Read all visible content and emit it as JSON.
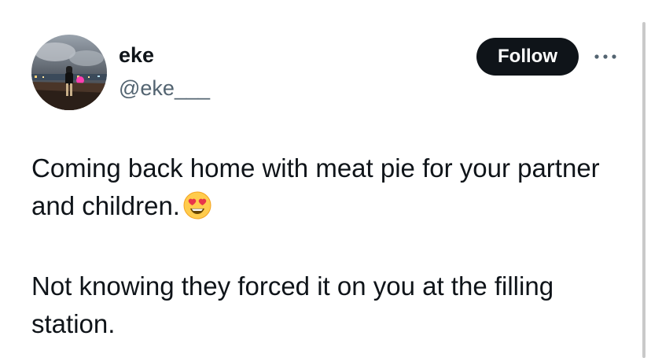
{
  "author": {
    "display_name": "eke",
    "handle": "@eke___",
    "avatar_icon": "profile-photo"
  },
  "actions": {
    "follow_label": "Follow",
    "more_icon": "more-options-icon"
  },
  "tweet": {
    "line1": "Coming back home with meat pie for your partner and children.",
    "emoji_icon": "heart-eyes-emoji",
    "line2": "Not knowing they forced it on you at the filling station."
  },
  "colors": {
    "text": "#0f1419",
    "secondary_text": "#536471",
    "follow_bg": "#0f1419",
    "follow_text": "#ffffff"
  }
}
